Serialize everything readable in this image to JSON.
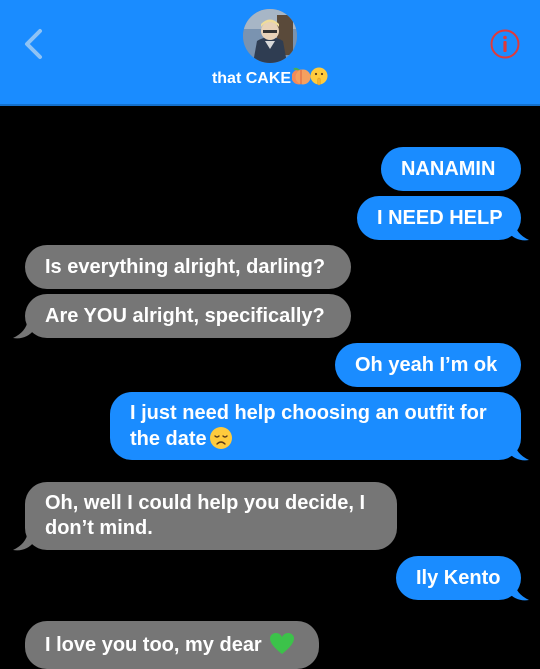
{
  "header": {
    "contact_name": "that CAKE",
    "contact_emojis": [
      "peach-emoji",
      "shushing-face-emoji"
    ],
    "back_icon": "chevron-left-icon",
    "info_icon": "info-icon",
    "avatar": "contact-avatar"
  },
  "colors": {
    "header_bg": "#1a8cff",
    "outgoing_bubble": "#1a8cff",
    "incoming_bubble": "#767676",
    "background": "#000000",
    "info_icon": "#e03a3a"
  },
  "messages": [
    {
      "direction": "outgoing",
      "text": "NANAMIN"
    },
    {
      "direction": "outgoing",
      "text": "I NEED HELP"
    },
    {
      "direction": "incoming",
      "text": "Is everything alright, darling?"
    },
    {
      "direction": "incoming",
      "text": "Are YOU alright, specifically?"
    },
    {
      "direction": "outgoing",
      "text": "Oh yeah I’m ok"
    },
    {
      "direction": "outgoing",
      "text": "I just need help choosing an outfit for the date",
      "emoji": "disappointed-face-emoji"
    },
    {
      "direction": "incoming",
      "text": "Oh, well I could help you decide, I don’t mind."
    },
    {
      "direction": "outgoing",
      "text": "Ily Kento"
    },
    {
      "direction": "incoming",
      "text": "I love you too, my dear",
      "emoji": "green-heart-emoji"
    }
  ]
}
